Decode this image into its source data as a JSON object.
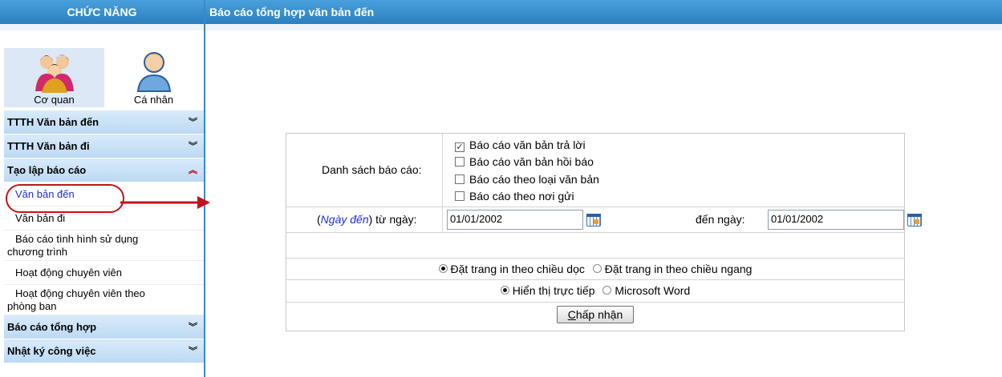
{
  "sidebar": {
    "title": "CHỨC NĂNG",
    "roles": [
      {
        "label": "Cơ quan",
        "icon": "group-users-icon",
        "active": true
      },
      {
        "label": "Cá nhân",
        "icon": "single-user-icon",
        "active": false
      }
    ],
    "groups": [
      {
        "label": "TTTH Văn bản đến",
        "icon": "chevron-double-down-icon"
      },
      {
        "label": "TTTH Văn bản đi",
        "icon": "chevron-double-down-icon"
      },
      {
        "label": "Tạo lập báo cáo",
        "icon": "chevron-double-up-icon",
        "expanded": true
      },
      {
        "label": "Báo cáo tổng hợp",
        "icon": "chevron-double-down-icon"
      },
      {
        "label": "Nhật ký công việc",
        "icon": "chevron-double-down-icon"
      }
    ],
    "subitems": [
      {
        "lines": [
          "Văn bản đến"
        ],
        "active": true
      },
      {
        "lines": [
          "Văn bản đi"
        ]
      },
      {
        "lines": [
          "Báo cáo tình hình sử dụng",
          "chương trình"
        ]
      },
      {
        "lines": [
          "Hoạt động chuyên viên"
        ]
      },
      {
        "lines": [
          "Hoạt động chuyên viên theo",
          "phòng ban"
        ]
      }
    ]
  },
  "page": {
    "title": "Báo cáo tổng hợp văn bản đến"
  },
  "form": {
    "list_label": "Danh sách báo cáo:",
    "checkboxes": [
      {
        "label": "Báo cáo văn bản trả lời",
        "checked": true,
        "mark": "✓"
      },
      {
        "label": "Báo cáo văn bản hồi báo",
        "checked": false,
        "mark": ""
      },
      {
        "label": "Báo cáo theo loại văn bản",
        "checked": false,
        "mark": ""
      },
      {
        "label": "Báo cáo theo nơi gửi",
        "checked": false,
        "mark": ""
      }
    ],
    "date_label_prefix": "(",
    "date_label_em": "Ngày đến",
    "date_label_suffix": ") từ ngày:",
    "from_date": "01/01/2002",
    "to_label": "đến ngày:",
    "to_date": "01/01/2002",
    "orientation": [
      {
        "label": "Đặt trang in theo chiều dọc",
        "selected": true
      },
      {
        "label": "Đặt trang in theo chiều ngang",
        "selected": false
      }
    ],
    "display": [
      {
        "label": "Hiển thị trực tiếp",
        "selected": true
      },
      {
        "label": "Microsoft Word",
        "selected": false
      }
    ],
    "submit_accesskey": "C",
    "submit_rest": "hấp nhận"
  },
  "colors": {
    "header_blue": "#2b7fbf",
    "menu_group": "#bcd9f3",
    "highlight_red": "#c0141a",
    "link_blue": "#1f2fd0"
  }
}
